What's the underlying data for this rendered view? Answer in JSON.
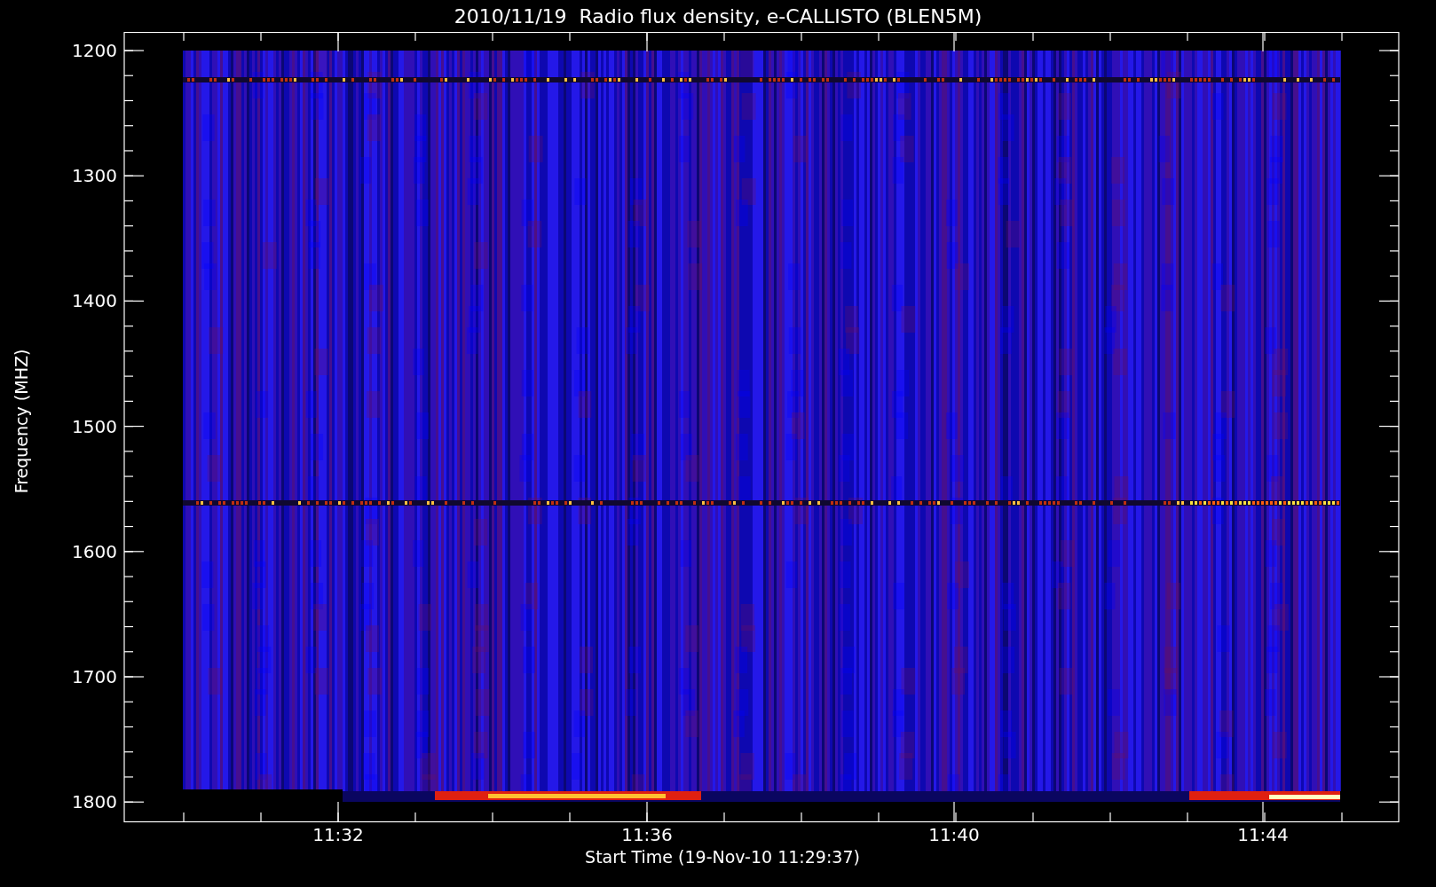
{
  "plot": {
    "title": "2010/11/19  Radio flux density, e-CALLISTO (BLEN5M)",
    "ylabel": "Frequency (MHZ)",
    "xlabel": "Start Time (19-Nov-10 11:29:37)",
    "yticks": [
      "1200",
      "1300",
      "1400",
      "1500",
      "1600",
      "1700",
      "1800"
    ],
    "xticks": [
      "11:32",
      "11:36",
      "11:40",
      "11:44"
    ]
  }
}
